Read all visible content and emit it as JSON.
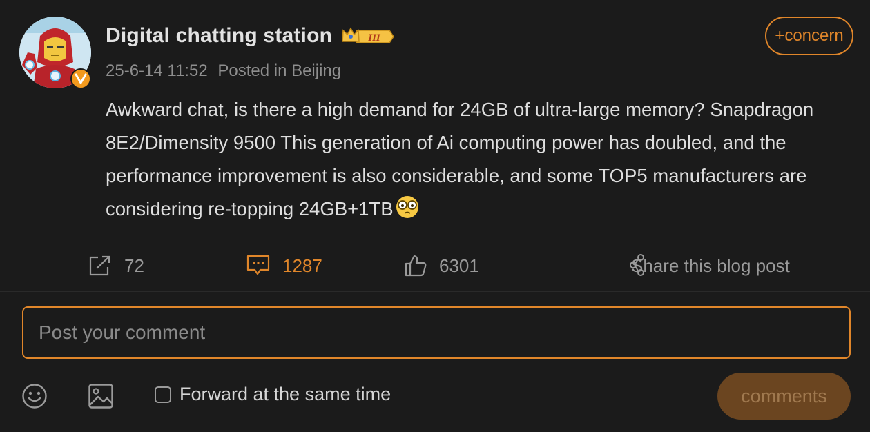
{
  "post": {
    "author": "Digital chatting station",
    "level_badge": "III",
    "timestamp": "25-6-14 11:52",
    "location": "Posted in Beijing",
    "follow_label": "+concern",
    "text": "Awkward chat, is there a high demand for 24GB of ultra-large memory? Snapdragon 8E2/Dimensity 9500 This generation of Ai computing power has doubled, and the performance improvement is also considerable, and some TOP5 manufacturers are considering re-topping 24GB+1TB",
    "emoji": "thinking-glasses-emoji"
  },
  "actions": {
    "repost_count": "72",
    "comment_count": "1287",
    "like_count": "6301",
    "share_label": "Share this blog post"
  },
  "comment_box": {
    "placeholder": "Post your comment",
    "forward_label": "Forward at the same time",
    "submit_label": "comments"
  },
  "icons": {
    "repost": "repost-icon",
    "comment": "comment-icon",
    "like": "thumbs-up-icon",
    "share": "share-icon",
    "emoji": "smiley-icon",
    "image": "image-icon",
    "verified": "verified-v-badge",
    "level": "crown-level-badge"
  },
  "colors": {
    "background": "#1b1b1b",
    "accent": "#e0862a",
    "text": "#dedede",
    "muted": "#8e8e8e",
    "submit_bg": "#6b4520"
  }
}
